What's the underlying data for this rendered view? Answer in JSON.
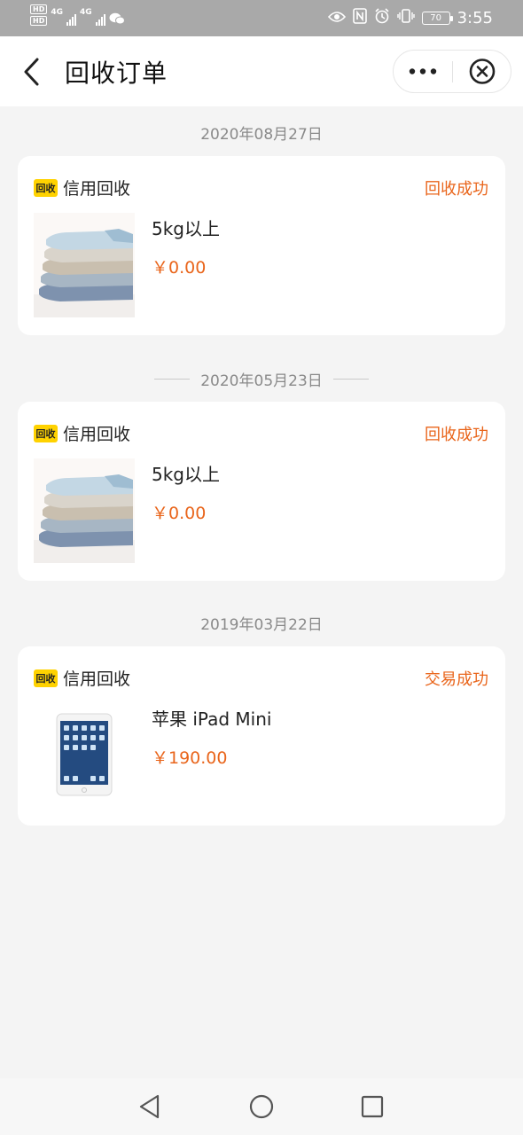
{
  "status_bar": {
    "hd_1": "HD",
    "hd_2": "HD",
    "net_1": "4G",
    "net_2": "4G",
    "battery": "70",
    "time": "3:55"
  },
  "nav": {
    "title": "回收订单"
  },
  "orders": [
    {
      "date": "2020年08月27日",
      "brand": "信用回收",
      "brand_logo": "回收",
      "status": "回收成功",
      "product": "5kg以上",
      "price": "￥0.00",
      "thumb": "clothes"
    },
    {
      "date": "2020年05月23日",
      "brand": "信用回收",
      "brand_logo": "回收",
      "status": "回收成功",
      "product": "5kg以上",
      "price": "￥0.00",
      "thumb": "clothes"
    },
    {
      "date": "2019年03月22日",
      "brand": "信用回收",
      "brand_logo": "回收",
      "status": "交易成功",
      "product": "苹果 iPad Mini",
      "price": "￥190.00",
      "thumb": "ipad"
    }
  ],
  "colors": {
    "accent": "#e9651b",
    "brand_yellow": "#ffd200",
    "background": "#f4f4f4"
  }
}
